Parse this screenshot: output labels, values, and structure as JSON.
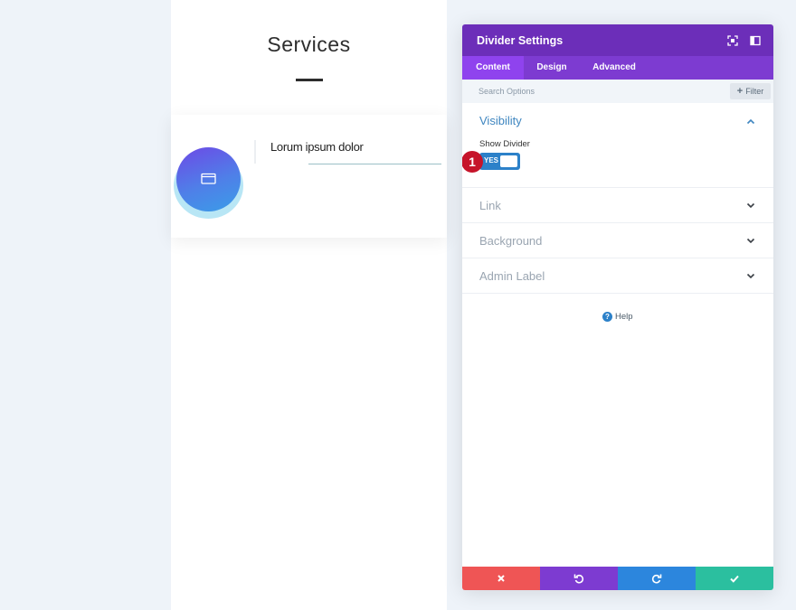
{
  "preview": {
    "section_title": "Services",
    "card_title": "Lorum ipsum dolor",
    "card_icon": "folder-icon"
  },
  "modal": {
    "title": "Divider Settings",
    "header_icons": [
      "fullscreen-icon",
      "sidebar-toggle-icon"
    ],
    "tabs": [
      {
        "label": "Content",
        "active": true
      },
      {
        "label": "Design",
        "active": false
      },
      {
        "label": "Advanced",
        "active": false
      }
    ],
    "search_placeholder": "Search Options",
    "filter_label": "Filter",
    "sections": [
      {
        "title": "Visibility",
        "open": true
      },
      {
        "title": "Link",
        "open": false
      },
      {
        "title": "Background",
        "open": false
      },
      {
        "title": "Admin Label",
        "open": false
      }
    ],
    "show_divider_label": "Show Divider",
    "toggle_value": "YES",
    "annotation_badge": "1",
    "help_label": "Help",
    "footer_buttons": [
      {
        "name": "discard",
        "icon": "close-icon",
        "color": "#ef5555"
      },
      {
        "name": "undo",
        "icon": "undo-icon",
        "color": "#7d3bd1"
      },
      {
        "name": "redo",
        "icon": "redo-icon",
        "color": "#2c86dd"
      },
      {
        "name": "save",
        "icon": "check-icon",
        "color": "#2bbf9f"
      }
    ]
  },
  "colors": {
    "header": "#6c2eb9",
    "tabs": "#7d3bd1",
    "active_tab": "#8f43ee",
    "accent_blue": "#2c81c9",
    "badge": "#c6142a"
  }
}
